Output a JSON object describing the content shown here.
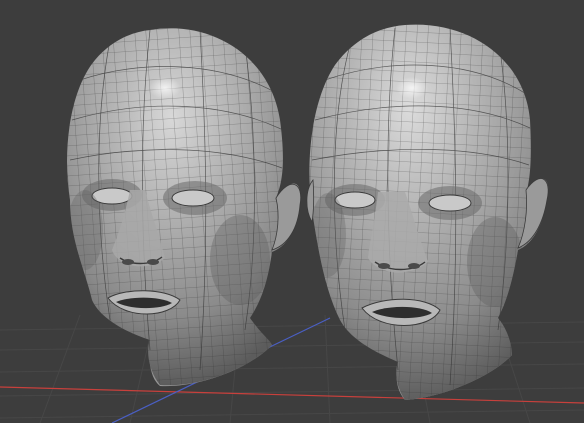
{
  "viewport": {
    "background_color": "#3d3d3d",
    "grid_color": "#474747",
    "x_axis_color": "#c8403c",
    "y_axis_color": "#4a5fc4",
    "mesh_base_color": "#9a9a9a",
    "wire_color": "#2b2b2b"
  },
  "scene_objects": [
    {
      "name": "head-left",
      "kind": "quad-mesh"
    },
    {
      "name": "head-right",
      "kind": "quad-mesh"
    }
  ]
}
